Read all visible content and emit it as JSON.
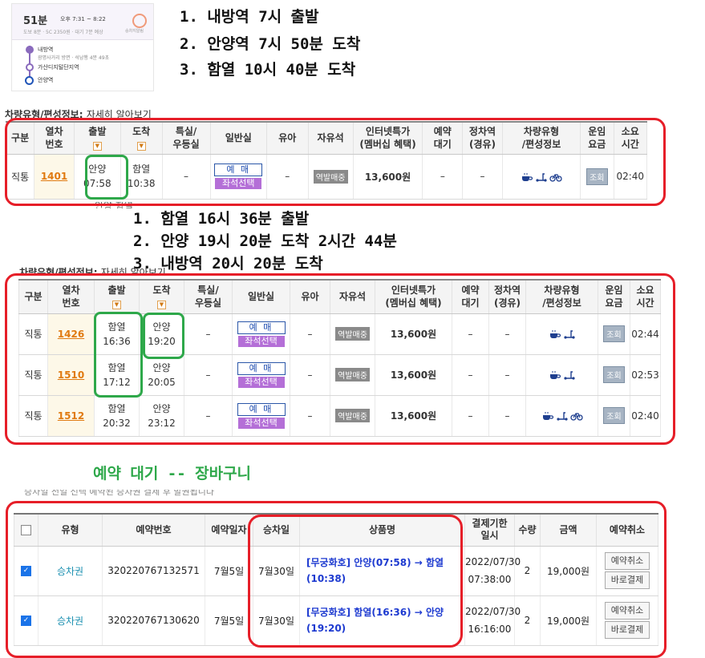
{
  "mini_map": {
    "duration": "51분",
    "time_range": "오후 7:31 ~ 8:22",
    "sub": "도보 8분 · 5C 2350원 · 대기 7분 예상",
    "sun_label": "승차지알림",
    "stations": [
      {
        "badge": "7",
        "name": "내방역",
        "segment": "광명사거리 방면 · 석남행 4분 49초"
      },
      {
        "badge": "",
        "name": "가산디지털단지역",
        "segment": ""
      },
      {
        "badge": "1",
        "name": "안양역",
        "segment": ""
      }
    ]
  },
  "notes_top": [
    "1. 내방역 7시 출발",
    "2. 안양역 7시 50분 도착",
    "3. 함열 10시 40분 도착"
  ],
  "notes_mid": [
    "1. 함열 16시 36분 출발",
    "2. 안양 19시 20분 도착 2시간 44분",
    "3. 내방역 20시 20분 도착"
  ],
  "vehicle_label": {
    "title": "차량유형/편성정보:",
    "link": "자세히 알아보기"
  },
  "train_headers": [
    "구분",
    "열차\n번호",
    "출발",
    "도착",
    "특실/\n우등실",
    "일반실",
    "유아",
    "자유석",
    "인터넷특가\n(멤버십 혜택)",
    "예약\n대기",
    "정차역\n(경유)",
    "차량유형\n/편성정보",
    "운임\n요금",
    "소요\n시간"
  ],
  "buttons": {
    "buy": "예 매",
    "seat": "좌석선택",
    "free": "역발매중",
    "fare": "조회"
  },
  "table1": [
    {
      "type": "직통",
      "no": "1401",
      "dep": "안양",
      "dep_t": "07:58",
      "arr": "함열",
      "arr_t": "10:38",
      "special": "–",
      "infant": "–",
      "price": "13,600원",
      "wait": "–",
      "stops": "–",
      "icons": [
        "cafe-icon",
        "scooter-icon",
        "bicycle-icon"
      ],
      "duration": "02:40"
    }
  ],
  "table2": [
    {
      "type": "직통",
      "no": "1426",
      "dep": "함열",
      "dep_t": "16:36",
      "arr": "안양",
      "arr_t": "19:20",
      "special": "–",
      "infant": "–",
      "price": "13,600원",
      "wait": "–",
      "stops": "–",
      "icons": [
        "cafe-icon",
        "scooter-icon"
      ],
      "duration": "02:44"
    },
    {
      "type": "직통",
      "no": "1510",
      "dep": "함열",
      "dep_t": "17:12",
      "arr": "안양",
      "arr_t": "20:05",
      "special": "–",
      "infant": "–",
      "price": "13,600원",
      "wait": "–",
      "stops": "–",
      "icons": [
        "cafe-icon",
        "scooter-icon"
      ],
      "duration": "02:53"
    },
    {
      "type": "직통",
      "no": "1512",
      "dep": "함열",
      "dep_t": "20:32",
      "arr": "안양",
      "arr_t": "23:12",
      "special": "–",
      "infant": "–",
      "price": "13,600원",
      "wait": "–",
      "stops": "–",
      "icons": [
        "cafe-icon",
        "scooter-icon",
        "bicycle-icon"
      ],
      "duration": "02:40"
    }
  ],
  "partial_row_text": "안양  함열",
  "cart_title": "예약 대기 -- 장바구니",
  "cart_headers": [
    "유형",
    "예약번호",
    "예약일자",
    "승차일",
    "상품명",
    "결제기한\n일시",
    "수량",
    "금액",
    "예약취소"
  ],
  "cart_buttons": {
    "cancel": "예약취소",
    "pay": "바로결제"
  },
  "cart_rows": [
    {
      "checked": true,
      "kind": "승차권",
      "res_no": "320220767132571",
      "res_date": "7월5일",
      "ride_date": "7월30일",
      "product": "[무궁화호] 안양(07:58) → 함열(10:38)",
      "deadline": "2022/07/30\n07:38:00",
      "qty": "2",
      "amount": "19,000원"
    },
    {
      "checked": true,
      "kind": "승차권",
      "res_no": "320220767130620",
      "res_date": "7월5일",
      "ride_date": "7월30일",
      "product": "[무궁화호] 함열(16:36) → 안양(19:20)",
      "deadline": "2022/07/30\n16:16:00",
      "qty": "2",
      "amount": "19,000원"
    }
  ],
  "colors": {
    "red_annotation": "#e61e28",
    "green_annotation": "#2ea84a",
    "seat_button": "#b46fd7",
    "train_no": "#e07a10",
    "product_link": "#1d3ad0"
  }
}
